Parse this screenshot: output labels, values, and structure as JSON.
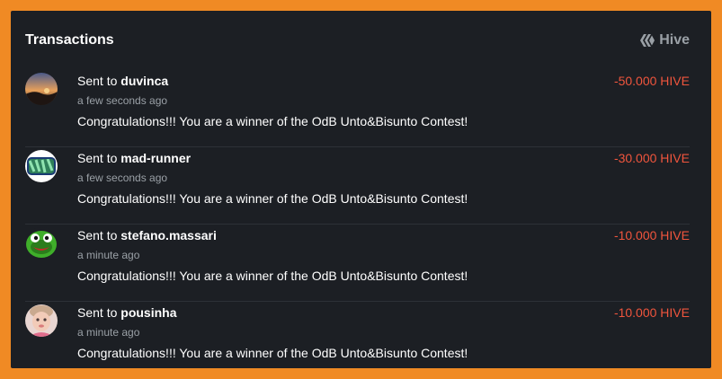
{
  "header": {
    "title": "Transactions",
    "brand": "Hive",
    "brand_icon": "hive-logo-icon"
  },
  "transactions": [
    {
      "prefix": "Sent to",
      "recipient": "duvinca",
      "time": "a few seconds ago",
      "memo": "Congratulations!!! You are a winner of the OdB Unto&Bisunto Contest!",
      "amount": "-50.000 HIVE"
    },
    {
      "prefix": "Sent to",
      "recipient": "mad-runner",
      "time": "a few seconds ago",
      "memo": "Congratulations!!! You are a winner of the OdB Unto&Bisunto Contest!",
      "amount": "-30.000 HIVE"
    },
    {
      "prefix": "Sent to",
      "recipient": "stefano.massari",
      "time": "a minute ago",
      "memo": "Congratulations!!! You are a winner of the OdB Unto&Bisunto Contest!",
      "amount": "-10.000 HIVE"
    },
    {
      "prefix": "Sent to",
      "recipient": "pousinha",
      "time": "a minute ago",
      "memo": "Congratulations!!! You are a winner of the OdB Unto&Bisunto Contest!",
      "amount": "-10.000 HIVE"
    }
  ],
  "colors": {
    "frame": "#f08a24",
    "panel": "#1c1f24",
    "negative_amount": "#f0553d",
    "muted_text": "#9aa0a6"
  }
}
